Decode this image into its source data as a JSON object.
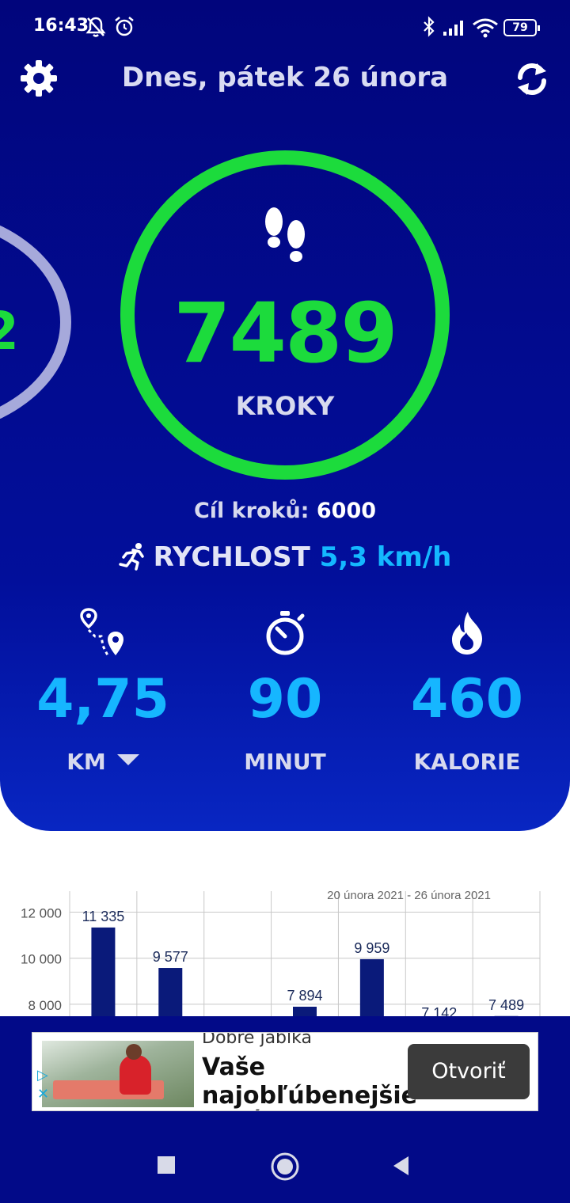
{
  "status_bar": {
    "time": "16:43",
    "battery": "79"
  },
  "header": {
    "title": "Dnes, pátek 26 února"
  },
  "steps": {
    "value": "7489",
    "unit": "KROKY",
    "prev_day_value": "2"
  },
  "goal": {
    "label": "Cíl kroků:",
    "value": "6000"
  },
  "speed": {
    "label": "RYCHLOST",
    "value": "5,3 km/h"
  },
  "metrics": [
    {
      "value": "4,75",
      "unit": "KM",
      "icon": "route-icon"
    },
    {
      "value": "90",
      "unit": "MINUT",
      "icon": "stopwatch-icon"
    },
    {
      "value": "460",
      "unit": "KALORIE",
      "icon": "flame-icon"
    }
  ],
  "colors": {
    "background": "#020f9b",
    "ring": "#1cdb3c",
    "value": "#16b6ff",
    "bar": "#0a1a7a"
  },
  "chart_data": {
    "type": "bar",
    "title": "20 února 2021 - 26 února 2021",
    "values": [
      11335,
      9577,
      0,
      7894,
      9959,
      7142,
      7489
    ],
    "value_labels": [
      "11 335",
      "9 577",
      "",
      "7 894",
      "9 959",
      "7 142",
      "7 489"
    ],
    "y_ticks": [
      "12 000",
      "10 000",
      "8 000"
    ],
    "y_tick_values": [
      12000,
      10000,
      8000
    ],
    "ylim": [
      7000,
      12500
    ],
    "grid": true
  },
  "ad": {
    "brand": "Dobre jablka",
    "headline": "Vaše najobľúbenejšie jablĺčka",
    "button": "Otvoriť",
    "choice_icon": "ad-choices-icon"
  },
  "nav": {
    "icons": [
      "recent-apps-icon",
      "home-icon",
      "back-icon"
    ]
  }
}
